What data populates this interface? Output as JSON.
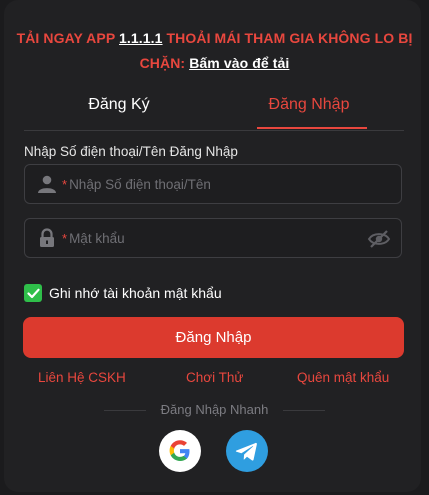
{
  "promo": {
    "line1_prefix": "TẢI NGAY APP ",
    "app_version": "1.1.1.1",
    "line1_suffix": " THOẢI MÁI THAM GIA KHÔNG LO BỊ",
    "line2_prefix": "CHẶN: ",
    "download_link": "Bấm vào để tải"
  },
  "tabs": [
    {
      "label": "Đăng Ký",
      "active": false
    },
    {
      "label": "Đăng Nhập",
      "active": true
    }
  ],
  "form": {
    "username_label": "Nhập Số điện thoại/Tên Đăng Nhập",
    "username_required_mark": "*",
    "username_placeholder": "Nhập Số điện thoại/Tên",
    "password_required_mark": "*",
    "password_placeholder": "Mật khẩu",
    "remember_label": "Ghi nhớ tài khoản mật khẩu",
    "remember_checked": true,
    "submit_label": "Đăng Nhập"
  },
  "links": {
    "support": "Liên Hệ CSKH",
    "trial": "Chơi Thử",
    "forgot": "Quên mật khẩu"
  },
  "quick_login": {
    "label": "Đăng Nhập Nhanh",
    "providers": [
      {
        "name": "google-icon"
      },
      {
        "name": "telegram-icon"
      }
    ]
  },
  "colors": {
    "accent": "#e8473e",
    "button": "#dc3a2e",
    "checkbox": "#2fbf4a",
    "telegram": "#2f9ee0"
  }
}
